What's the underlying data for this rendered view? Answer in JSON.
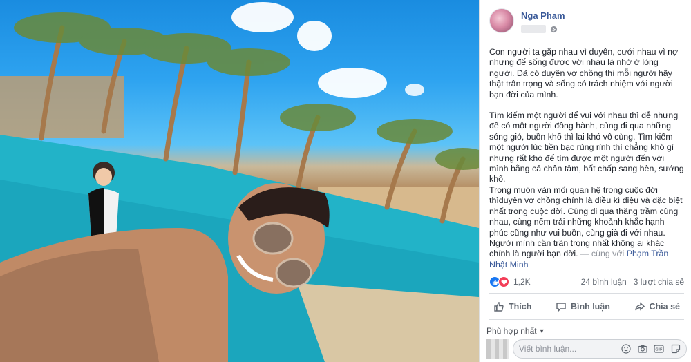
{
  "post": {
    "author": "Nga Pham",
    "paragraphs": [
      "Con người ta gặp nhau vì duyên, cưới nhau vì nợ nhưng để sống được với nhau là nhờ ở lòng người. Đã có duyên vợ chồng thì mỗi người hãy thật trân trọng và sống có trách nhiệm với người bạn đời của mình.",
      "Tìm kiếm một người để vui với nhau thì dễ nhưng để có một người đồng hành, cùng đi qua những sóng gió, buồn khổ thì lại khó vô cùng. Tìm kiếm một người lúc tiền bạc rủng rỉnh thì chẳng khó gì nhưng rất khó để tìm được một người đến với mình bằng cả chân tâm, bất chấp sang hèn, sướng khổ.",
      "Trong muôn vàn mối quan hệ trong cuộc đời thìduyên vợ chồng chính là điều kì diệu và đặc biệt nhất trong cuộc đời. Cùng đi qua thăng trầm cùng nhau, cùng nếm trải những khoảnh khắc hạnh phúc cũng như vui buồn, cùng già đi với nhau. Người mình cần trân trọng nhất không ai khác chính là người bạn đời."
    ],
    "with_text": "— cùng với",
    "tagged_user": "Phạm Trần Nhật Minh"
  },
  "stats": {
    "reaction_count": "1,2K",
    "comments": "24 bình luận",
    "shares": "3 lượt chia sẻ"
  },
  "actions": {
    "like": "Thích",
    "comment": "Bình luận",
    "share": "Chia sẻ"
  },
  "comments": {
    "sort_label": "Phù hợp nhất",
    "placeholder": "Viết bình luận..."
  },
  "colors": {
    "link": "#385898",
    "like": "#1877f2",
    "love": "#f33e58"
  }
}
